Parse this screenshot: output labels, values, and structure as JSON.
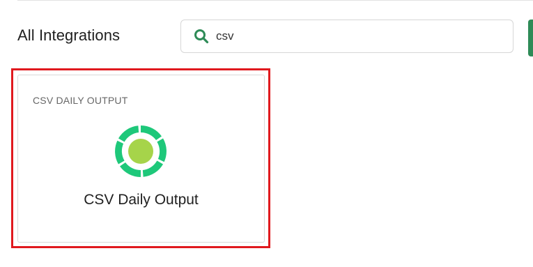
{
  "header": {
    "title": "All Integrations"
  },
  "search": {
    "value": "csv",
    "icon": "search-icon"
  },
  "results": [
    {
      "eyebrow": "CSV DAILY OUTPUT",
      "name": "CSV Daily Output",
      "icon": "csv-daily-output-logo-icon",
      "logo_colors": {
        "ring": "#1ec87a",
        "center": "#a6d44a"
      }
    }
  ],
  "colors": {
    "accent": "#2e8b57",
    "highlight": "#e0191e",
    "search_icon": "#2e8b57"
  }
}
